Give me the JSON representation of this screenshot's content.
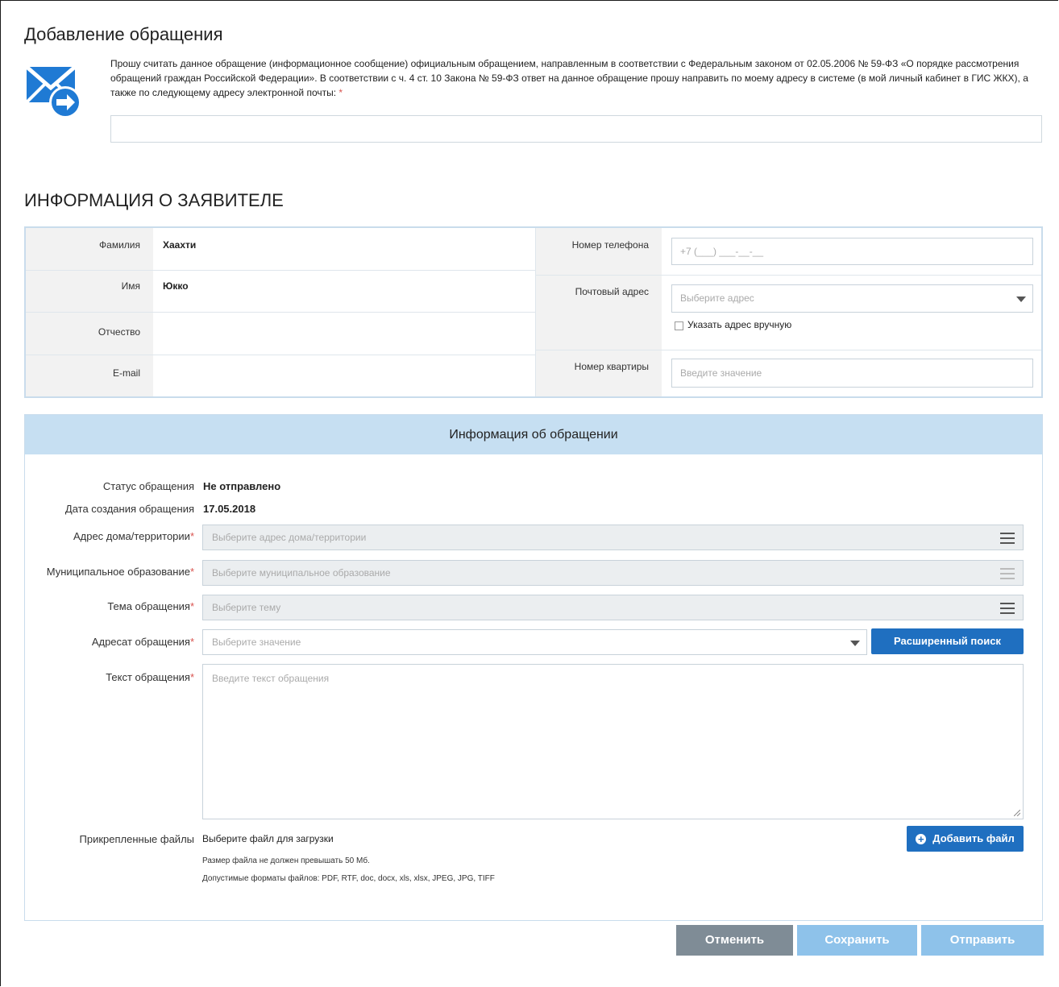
{
  "page": {
    "title": "Добавление обращения",
    "intro_text": "Прошу считать данное обращение (информационное сообщение) официальным обращением, направленным в соответствии с Федеральным законом от 02.05.2006 № 59-ФЗ «О порядке рассмотрения обращений граждан Российской Федерации». В соответствии с ч. 4 ст. 10 Закона № 59-ФЗ ответ на данное обращение прошу направить по моему адресу в системе (в мой личный кабинет в ГИС ЖКХ), а также по следующему адресу электронной почты:",
    "required_mark": "*",
    "email_value": ""
  },
  "applicant": {
    "section_title": "ИНФОРМАЦИЯ О ЗАЯВИТЕЛЕ",
    "last_name_label": "Фамилия",
    "last_name_value": "Хаахти",
    "first_name_label": "Имя",
    "first_name_value": "Юкко",
    "patronymic_label": "Отчество",
    "patronymic_value": "",
    "email_label": "E-mail",
    "email_value": "",
    "phone_label": "Номер телефона",
    "phone_placeholder": "+7 (___) ___-__-__",
    "postal_label": "Почтовый адрес",
    "postal_placeholder": "Выберите адрес",
    "manual_address_label": "Указать адрес вручную",
    "manual_address_checked": false,
    "apartment_label": "Номер квартиры",
    "apartment_placeholder": "Введите значение"
  },
  "appeal": {
    "header": "Информация об обращении",
    "status_label": "Статус обращения",
    "status_value": "Не отправлено",
    "created_label": "Дата создания обращения",
    "created_value": "17.05.2018",
    "house_label": "Адрес дома/территории",
    "house_placeholder": "Выберите адрес дома/территории",
    "municipality_label": "Муниципальное образование",
    "municipality_placeholder": "Выберите муниципальное образование",
    "topic_label": "Тема обращения",
    "topic_placeholder": "Выберите тему",
    "addressee_label": "Адресат обращения",
    "addressee_placeholder": "Выберите значение",
    "advanced_search_label": "Расширенный поиск",
    "text_label": "Текст обращения",
    "text_placeholder": "Введите текст обращения",
    "files_label": "Прикрепленные файлы",
    "files_choose": "Выберите файл для загрузки",
    "add_file_label": "Добавить файл",
    "size_note": "Размер файла не должен превышать 50 Мб.",
    "formats_note": "Допустимые форматы файлов: PDF, RTF, doc, docx, xls, xlsx, JPEG, JPG, TIFF"
  },
  "footer": {
    "cancel_label": "Отменить",
    "save_label": "Сохранить",
    "send_label": "Отправить"
  },
  "colors": {
    "accent_blue": "#1f6fc0",
    "header_blue": "#c6dff2",
    "cancel_gray": "#7f8c96",
    "disabled_blue": "#8ec2ea",
    "required_red": "#d9534f"
  }
}
